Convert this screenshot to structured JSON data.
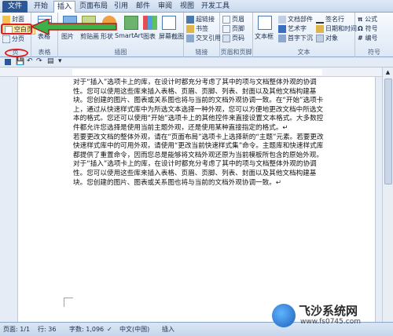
{
  "tabs": [
    "文件",
    "开始",
    "插入",
    "页面布局",
    "引用",
    "邮件",
    "审阅",
    "视图",
    "开发工具"
  ],
  "ribbon": {
    "pages": {
      "cover": "封面",
      "blank": "空白页",
      "break": "分页",
      "label": "页"
    },
    "tables": {
      "table": "表格",
      "label": "表格"
    },
    "illustrations": {
      "picture": "图片",
      "clipart": "剪贴画",
      "shapes": "形状",
      "smartart": "SmartArt",
      "chart": "图表",
      "screenshot": "屏幕截图",
      "label": "插图"
    },
    "links": {
      "hyperlink": "超链接",
      "bookmark": "书签",
      "crossref": "交叉引用",
      "label": "链接"
    },
    "headerfooter": {
      "header": "页眉",
      "footer": "页脚",
      "pagenum": "页码",
      "label": "页眉和页脚"
    },
    "text": {
      "textbox": "文本框",
      "docparts": "文档部件",
      "wordart": "艺术字",
      "dropcap": "首字下沉",
      "signature": "签名行",
      "datetime": "日期和时间",
      "object": "对象",
      "label": "文本"
    },
    "symbols": {
      "equation": "公式",
      "symbol": "符号",
      "number": "编号",
      "label": "符号"
    }
  },
  "document": {
    "paragraphs": [
      "对于“插入”选项卡上的库，在设计时都充分考虑了其中的项与文档整体外观的协调性。您可以使用这些库来插入表格、页眉、页脚、列表、封面以及其他文档构建基块。您创建的图片、图表或关系图也将与当前的文档外观协调一致。在“开始”选项卡上，通过从快速样式库中为所选文本选择一种外观，您可以方便地更改文档中所选文本的格式。您还可以使用“开始”选项卡上的其他控件来直接设置文本格式。大多数控件都允许您选择是使用当前主题外观，还是使用某种直接指定的格式。↵",
      "若要更改文档的整体外观，请在“页面布局”选项卡上选择新的“主题”元素。若要更改快速样式库中的可用外观，请使用“更改当前快速样式集”命令。主题库和快速样式库都提供了重置命令，因而您总是能够将文档外观还原为当前模板所包含的原始外观。对于“插入”选项卡上的库，在设计时都充分考虑了其中的项与文档整体外观的协调性。您可以使用这些库来插入表格、页眉、页脚、列表、封面以及其他文档构建基块。您创建的图片、图表或关系图也将与当前的文档外观协调一致。↵"
    ]
  },
  "status": {
    "page": "页面: 1/1",
    "words": "字数: 1,096",
    "lang": "中文(中国)",
    "mode": "插入",
    "row": "行: 36"
  },
  "watermark": {
    "title": "飞沙系统网",
    "url": "www.fs0745.com"
  }
}
